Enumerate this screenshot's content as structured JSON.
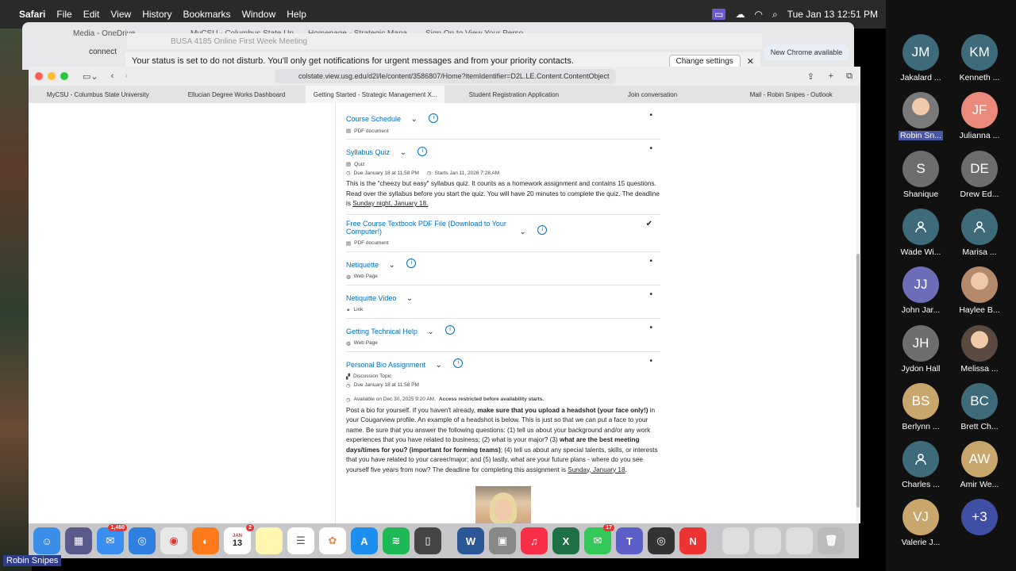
{
  "menubar": {
    "app": "Safari",
    "items": [
      "File",
      "Edit",
      "View",
      "History",
      "Bookmarks",
      "Window",
      "Help"
    ],
    "clock": "Tue Jan 13  12:51 PM"
  },
  "background_window": {
    "tabs": [
      "Media - OneDrive",
      "MyCSU - Columbus State Un",
      "Homepage - Strategic Mana",
      "Sign On to View Your Perso"
    ],
    "address": "connect",
    "meeting_title": "BUSA 4185 Online First Week Meeting",
    "dnd_message": "Your status is set to do not disturb. You'll only get notifications for urgent messages and from your priority contacts.",
    "dnd_button": "Change settings",
    "chrome_update": "New Chrome available"
  },
  "browser": {
    "url": "colstate.view.usg.edu/d2l/le/content/3586807/Home?itemIdentifier=D2L.LE.Content.ContentObject",
    "tabs": [
      {
        "label": "MyCSU - Columbus State University",
        "active": false
      },
      {
        "label": "Ellucian Degree Works Dashboard",
        "active": false
      },
      {
        "label": "Getting Started - Strategic Management X...",
        "active": true
      },
      {
        "label": "Student Registration Application",
        "active": false
      },
      {
        "label": "Join conversation",
        "active": false
      },
      {
        "label": "Mail - Robin Snipes - Outlook",
        "active": false
      }
    ]
  },
  "content": {
    "items": [
      {
        "title": "Course Schedule",
        "type": "PDF document",
        "status": "•"
      },
      {
        "title": "Syllabus Quiz",
        "type": "Quiz",
        "due": "Due January 18 at 11:58 PM",
        "starts": "Starts Jan 11, 2026 7:28 AM",
        "desc_1": "This is the \"cheezy but easy\" syllabus quiz. It counts as a homework assignment and contains 15 questions. Read over the syllabus before you start the quiz.  You will have 20 minutes to complete the quiz. The deadline is ",
        "desc_link": "Sunday night, January 18.",
        "status": "•"
      },
      {
        "title": "Free Course Textbook PDF File (Download to Your Computer!)",
        "type": "PDF document",
        "status": "✔"
      },
      {
        "title": "Netiquette",
        "type": "Web Page",
        "status": "•"
      },
      {
        "title": "Netiquitte Video",
        "type": "Link",
        "status": "•"
      },
      {
        "title": "Getting Technical Help",
        "type": "Web Page",
        "status": "•"
      },
      {
        "title": "Personal Bio Assignment",
        "type": "Discussion Topic",
        "due": "Due January 18 at 11:58 PM",
        "available": "Available on Dec 30, 2025 9:20 AM.",
        "restricted": "Access restricted before availability starts.",
        "p1": "Post a bio for yourself.  If you haven't already, ",
        "b1": "make sure that you upload a headshot (your face only!)",
        "p2": " in your Cougarview profile. An example of a headshot is below. This is just so that we can put a face to your name. Be sure that you answer the following questions:  (1) tell us about your background and/or any work experiences that you have related to business; (2) what is your major? (3) ",
        "b2": "what are the best meeting days/times for you? (important for forming teams)",
        "p3": "; (4) tell us about any special talents, skills, or interests that you have related to your career/major; and (5) lastly, what are your future plans - where do you see yourself five years from now?  The deadline for completing this assignment is ",
        "link": "Sunday, January 18",
        "end": ".",
        "status": "•"
      }
    ]
  },
  "dock": {
    "mail_badge": "1,460",
    "calendar_month": "JAN",
    "calendar_day": "13",
    "calendar_badge": "2",
    "messages_badge": "17"
  },
  "self_name": "Robin Snipes",
  "participants": [
    {
      "initials": "JM",
      "name": "Jakalard ...",
      "color": "#3d6b7a"
    },
    {
      "initials": "KM",
      "name": "Kenneth ...",
      "color": "#3d6b7a"
    },
    {
      "initials": "",
      "name": "Robin Sn...",
      "color": "#7a7a7a",
      "photo": true,
      "highlight": true
    },
    {
      "initials": "JF",
      "name": "Julianna ...",
      "color": "#e98a7a"
    },
    {
      "initials": "S",
      "name": "Shanique",
      "color": "#6d6d6d"
    },
    {
      "initials": "DE",
      "name": "Drew Ed...",
      "color": "#6d6d6d"
    },
    {
      "initials": "",
      "name": "Wade Wi...",
      "color": "#3d6b7a",
      "person": true
    },
    {
      "initials": "",
      "name": "Marisa ...",
      "color": "#3d6b7a",
      "person": true
    },
    {
      "initials": "JJ",
      "name": "John Jar...",
      "color": "#6b6db8"
    },
    {
      "initials": "",
      "name": "Haylee B...",
      "color": "#b58a6a",
      "photo": true
    },
    {
      "initials": "JH",
      "name": "Jydon Hall",
      "color": "#6d6d6d"
    },
    {
      "initials": "",
      "name": "Melissa ...",
      "color": "#5a4a40",
      "photo": true
    },
    {
      "initials": "BS",
      "name": "Berlynn ...",
      "color": "#c9a66b"
    },
    {
      "initials": "BC",
      "name": "Brett Ch...",
      "color": "#3d6b7a"
    },
    {
      "initials": "",
      "name": "Charles ...",
      "color": "#3d6b7a",
      "person": true
    },
    {
      "initials": "AW",
      "name": "Amir We...",
      "color": "#c9a66b"
    },
    {
      "initials": "VJ",
      "name": "Valerie J...",
      "color": "#c9a66b"
    },
    {
      "initials": "+3",
      "name": "",
      "color": "#3f4fa3"
    }
  ]
}
